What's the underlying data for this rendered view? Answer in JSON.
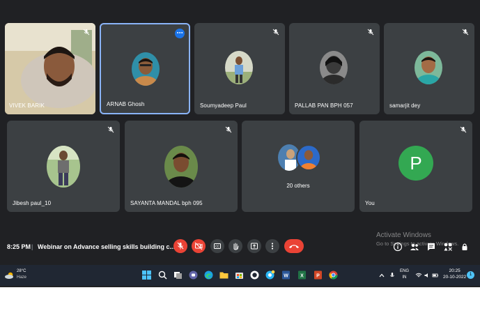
{
  "participants": {
    "row1": [
      {
        "name": "VIVEK BARIK",
        "muted": true
      },
      {
        "name": "ARNAB Ghosh",
        "speaking": true
      },
      {
        "name": "Soumyadeep Paul",
        "muted": true
      },
      {
        "name": "PALLAB PAN BPH 057",
        "muted": true
      },
      {
        "name": "samarjit dey",
        "muted": true
      }
    ],
    "row2": [
      {
        "name": "Jibesh paul_10",
        "muted": true
      },
      {
        "name": "SAYANTA MANDAL bph 095",
        "muted": true
      },
      {
        "name": "20 others"
      },
      {
        "name": "You",
        "initial": "P",
        "muted": true
      }
    ]
  },
  "meeting_bar": {
    "time": "8:25 PM",
    "separator": "|",
    "title": "Webinar on Advance selling skills building c...",
    "controls": [
      "mic-off-icon",
      "camera-off-icon",
      "captions-icon",
      "raise-hand-icon",
      "present-icon",
      "more-options-icon",
      "end-call-icon"
    ],
    "right_icons": [
      "info-icon",
      "people-icon",
      "chat-icon",
      "activities-icon",
      "host-controls-icon"
    ],
    "activate_title": "Activate Windows",
    "activate_sub": "Go to Settings to activate Windows."
  },
  "taskbar": {
    "weather_temp": "28°C",
    "weather_desc": "Haze",
    "tray_lang_1": "ENG",
    "tray_lang_2": "IN",
    "clock_time": "20:25",
    "clock_date": "20-10-2022",
    "notification_count": "1"
  },
  "colors": {
    "background": "#202124",
    "tile": "#3c4043",
    "speaking_border": "#8ab4f8",
    "end_call": "#ea4335",
    "you_avatar": "#33a852"
  }
}
